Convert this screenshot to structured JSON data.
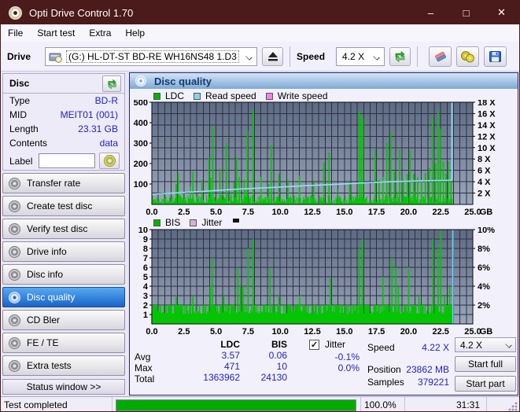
{
  "window": {
    "title": "Opti Drive Control 1.70",
    "controls": {
      "minimize": "–",
      "maximize": "□",
      "close": "✕"
    }
  },
  "menu": {
    "items": [
      "File",
      "Start test",
      "Extra",
      "Help"
    ]
  },
  "toolbar": {
    "drive_label": "Drive",
    "drive_value": "(G:)  HL-DT-ST BD-RE  WH16NS48 1.D3",
    "speed_label": "Speed",
    "speed_value": "4.2 X",
    "icons": [
      "eject-icon",
      "refresh-icon",
      "eraser-icon",
      "discs-icon",
      "save-icon"
    ]
  },
  "sidebar": {
    "disc_panel": {
      "title": "Disc",
      "rows": [
        {
          "label": "Type",
          "value": "BD-R"
        },
        {
          "label": "MID",
          "value": "MEIT01 (001)"
        },
        {
          "label": "Length",
          "value": "23.31 GB"
        },
        {
          "label": "Contents",
          "value": "data"
        }
      ],
      "label_field": {
        "label": "Label",
        "value": ""
      }
    },
    "nav": [
      {
        "label": "Transfer rate",
        "active": false
      },
      {
        "label": "Create test disc",
        "active": false
      },
      {
        "label": "Verify test disc",
        "active": false
      },
      {
        "label": "Drive info",
        "active": false
      },
      {
        "label": "Disc info",
        "active": false
      },
      {
        "label": "Disc quality",
        "active": true
      },
      {
        "label": "CD Bler",
        "active": false
      },
      {
        "label": "FE / TE",
        "active": false
      },
      {
        "label": "Extra tests",
        "active": false
      }
    ],
    "status_window_label": "Status window >>"
  },
  "main": {
    "header": "Disc quality"
  },
  "stats": {
    "col_ldc": "LDC",
    "col_bis": "BIS",
    "jitter_label": "Jitter",
    "jitter_checked": true,
    "rows": [
      {
        "label": "Avg",
        "ldc": "3.57",
        "bis": "0.06",
        "jitter": "-0.1%"
      },
      {
        "label": "Max",
        "ldc": "471",
        "bis": "10",
        "jitter": "0.0%"
      },
      {
        "label": "Total",
        "ldc": "1363962",
        "bis": "24130",
        "jitter": ""
      }
    ],
    "speed_label": "Speed",
    "speed_value": "4.22 X",
    "position_label": "Position",
    "position_value": "23862 MB",
    "samples_label": "Samples",
    "samples_value": "379221",
    "speed_select": "4.2 X",
    "start_full": "Start full",
    "start_part": "Start part"
  },
  "statusbar": {
    "text": "Test completed",
    "percent": "100.0%",
    "time": "31:31"
  },
  "colors": {
    "titlebar": "#4b1a1a",
    "value_blue": "#2121cc",
    "series_green": "#05c405",
    "read_speed_blue": "#92dcfa",
    "write_speed_pink": "#f77ff0",
    "jitter_pink": "#d9aede",
    "plot_bg_top": "#5c6a84",
    "plot_bg_bottom": "#9ba6ba",
    "progress_green": "#00ab00",
    "active_nav": "#1b63c6"
  },
  "chart_data": [
    {
      "type": "bar",
      "title": "LDC errors and read/write speed vs disc position",
      "legend": [
        {
          "label": "LDC",
          "color": "#00b400"
        },
        {
          "label": "Read speed",
          "color": "#82d4f5"
        },
        {
          "label": "Write speed",
          "color": "#f77ff0"
        }
      ],
      "xlim": [
        0,
        25
      ],
      "x_ticks": [
        0,
        2.5,
        5,
        7.5,
        10,
        12.5,
        15,
        17.5,
        20,
        22.5,
        25
      ],
      "x_unit": "GB",
      "ylim": [
        0,
        500
      ],
      "y_ticks": [
        100,
        200,
        300,
        400,
        500
      ],
      "y2lim": [
        0,
        18
      ],
      "y2_ticks": [
        2,
        4,
        6,
        8,
        10,
        12,
        14,
        16,
        18
      ],
      "y2_suffix": " X",
      "grid_x_step": 0.5,
      "grid_y2_step": 2,
      "data_end": 23.4,
      "series": [
        {
          "name": "LDC",
          "type": "noise",
          "color": "#05c405",
          "seed": 7,
          "step": 0.06,
          "min": 3,
          "max": 45
        },
        {
          "name": "LDC",
          "type": "spikes",
          "color": "#05c405",
          "points": [
            [
              1.9,
              100
            ],
            [
              2.05,
              155
            ],
            [
              3.0,
              90
            ],
            [
              3.2,
              160
            ],
            [
              3.9,
              120
            ],
            [
              4.45,
              230
            ],
            [
              4.6,
              130
            ],
            [
              4.75,
              380
            ],
            [
              5.3,
              175
            ],
            [
              5.8,
              300
            ],
            [
              6.4,
              110
            ],
            [
              6.6,
              230
            ],
            [
              6.8,
              135
            ],
            [
              7.2,
              120
            ],
            [
              7.45,
              360
            ],
            [
              7.9,
              460
            ],
            [
              8.5,
              135
            ],
            [
              9.1,
              100
            ],
            [
              9.3,
              290
            ],
            [
              9.9,
              150
            ],
            [
              10.6,
              120
            ],
            [
              11.5,
              140
            ],
            [
              12.6,
              110
            ],
            [
              13.4,
              205
            ],
            [
              13.8,
              255
            ],
            [
              15.4,
              110
            ],
            [
              16.15,
              460
            ],
            [
              16.3,
              440
            ],
            [
              16.45,
              420
            ],
            [
              17.4,
              270
            ],
            [
              17.7,
              120
            ],
            [
              18.0,
              135
            ],
            [
              18.3,
              300
            ],
            [
              18.6,
              355
            ],
            [
              18.9,
              160
            ],
            [
              19.3,
              270
            ],
            [
              19.6,
              120
            ],
            [
              19.9,
              150
            ],
            [
              20.1,
              265
            ],
            [
              20.4,
              150
            ],
            [
              20.7,
              135
            ],
            [
              21.0,
              120
            ],
            [
              21.3,
              155
            ],
            [
              21.6,
              180
            ],
            [
              21.85,
              425
            ],
            [
              22.1,
              200
            ],
            [
              22.3,
              465
            ],
            [
              22.45,
              370
            ],
            [
              22.7,
              210
            ],
            [
              22.9,
              150
            ],
            [
              23.1,
              210
            ],
            [
              23.3,
              120
            ]
          ]
        },
        {
          "name": "Read speed",
          "type": "line",
          "axis": "y2",
          "color": "#92dcfa",
          "points": [
            [
              0,
              1.8
            ],
            [
              2,
              2.05
            ],
            [
              4,
              2.3
            ],
            [
              6,
              2.6
            ],
            [
              8,
              2.85
            ],
            [
              10,
              3.05
            ],
            [
              12,
              3.3
            ],
            [
              14,
              3.5
            ],
            [
              16,
              3.72
            ],
            [
              18,
              3.95
            ],
            [
              20,
              4.1
            ],
            [
              22,
              4.2
            ],
            [
              23.35,
              4.25
            ]
          ],
          "end_spike": [
            23.38,
            18
          ]
        }
      ]
    },
    {
      "type": "bar",
      "title": "BIS errors and jitter vs disc position",
      "legend": [
        {
          "label": "BIS",
          "color": "#00b400"
        },
        {
          "label": "Jitter",
          "color": "#d9aede"
        }
      ],
      "xlim": [
        0,
        25
      ],
      "x_ticks": [
        0,
        2.5,
        5,
        7.5,
        10,
        12.5,
        15,
        17.5,
        20,
        22.5,
        25
      ],
      "x_unit": "GB",
      "ylim": [
        0,
        10
      ],
      "y_ticks": [
        1,
        2,
        3,
        4,
        5,
        6,
        7,
        8,
        9,
        10
      ],
      "y2lim": [
        0,
        10
      ],
      "y2_ticks": [
        2,
        4,
        6,
        8,
        10
      ],
      "y2_suffix": "%",
      "grid_x_step": 0.5,
      "grid_y_step": 1,
      "data_end": 23.4,
      "series": [
        {
          "name": "BIS",
          "type": "base",
          "color": "#05c405",
          "level": 1
        },
        {
          "name": "BIS",
          "type": "noise2",
          "color": "#05c405",
          "seed": 13,
          "step": 0.07,
          "density": 0.55
        },
        {
          "name": "BIS",
          "type": "spikes",
          "color": "#05c405",
          "points": [
            [
              1.9,
              3
            ],
            [
              3.2,
              3
            ],
            [
              4.55,
              4
            ],
            [
              4.7,
              7
            ],
            [
              5.6,
              3
            ],
            [
              6.7,
              6
            ],
            [
              6.9,
              4
            ],
            [
              7.1,
              4
            ],
            [
              7.5,
              8
            ],
            [
              7.9,
              9
            ],
            [
              9.2,
              6
            ],
            [
              9.9,
              3
            ],
            [
              11.5,
              3
            ],
            [
              13.9,
              5
            ],
            [
              16.15,
              8
            ],
            [
              16.4,
              9
            ],
            [
              18.0,
              5
            ],
            [
              18.7,
              7
            ],
            [
              19.0,
              6
            ],
            [
              19.2,
              4
            ],
            [
              20.0,
              6
            ],
            [
              20.8,
              3
            ],
            [
              21.9,
              9
            ],
            [
              22.3,
              8
            ],
            [
              22.5,
              10
            ],
            [
              22.8,
              3
            ],
            [
              23.0,
              2
            ],
            [
              23.2,
              4
            ]
          ]
        },
        {
          "name": "end-marker",
          "type": "vline",
          "color": "#70d0f4",
          "x": 23.45
        }
      ]
    }
  ]
}
